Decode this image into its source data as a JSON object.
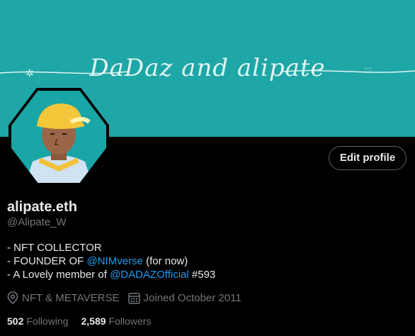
{
  "banner": {
    "text": "DaDaz and alipate"
  },
  "profile": {
    "display_name": "alipate.eth",
    "handle": "@Alipate_W",
    "edit_label": "Edit profile",
    "bio": {
      "line1": "- NFT COLLECTOR",
      "line2_prefix": "- FOUNDER OF ",
      "line2_mention": "@NIMverse",
      "line2_suffix": " (for now)",
      "line3_prefix": "- A Lovely member of ",
      "line3_mention": "@DADAZOfficial",
      "line3_suffix": " #593"
    },
    "location": "NFT & METAVERSE",
    "joined": "Joined October 2011",
    "following_count": "502",
    "following_label": "Following",
    "followers_count": "2,589",
    "followers_label": "Followers"
  },
  "icons": [
    "location-pin-icon",
    "calendar-icon"
  ],
  "colors": {
    "banner": "#1fa6a6",
    "accent": "#1d9bf0",
    "muted": "#71767b"
  }
}
